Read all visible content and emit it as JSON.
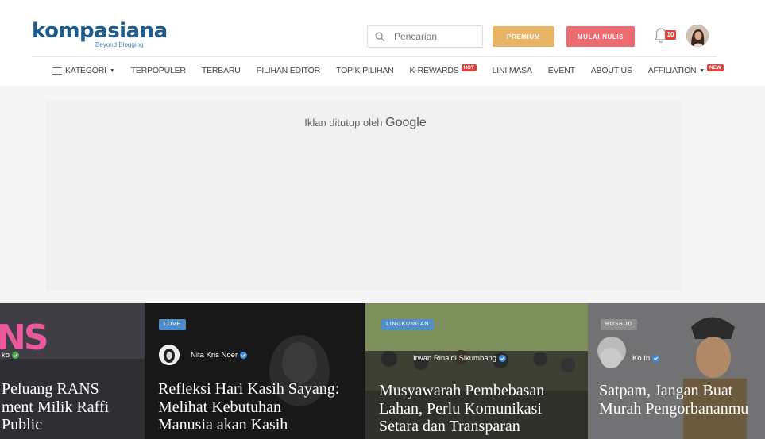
{
  "header": {
    "logo_text": "kompasiana",
    "logo_tagline": "Beyond Blogging",
    "search_placeholder": "Pencarian",
    "premium_label": "PREMIUM",
    "write_label": "MULAI NULIS",
    "notification_count": "10",
    "brand_color": "#1d5c8c",
    "premium_color": "#e7b466",
    "write_color": "#ec6a70"
  },
  "nav": {
    "items": [
      {
        "label": "KATEGORI",
        "icon": "hamburger-icon",
        "caret": true
      },
      {
        "label": "TERPOPULER"
      },
      {
        "label": "TERBARU"
      },
      {
        "label": "PILIHAN EDITOR"
      },
      {
        "label": "TOPIK PILIHAN"
      },
      {
        "label": "K-REWARDS",
        "badge": "HOT"
      },
      {
        "label": "LINI MASA"
      },
      {
        "label": "EVENT"
      },
      {
        "label": "ABOUT US"
      },
      {
        "label": "AFFILIATION",
        "caret": true,
        "badge": "NEW"
      }
    ]
  },
  "ad": {
    "text": "Iklan ditutup oleh",
    "brand": "Google"
  },
  "hero": {
    "cards": [
      {
        "tag": "",
        "author": "ko",
        "title_lines": [
          "Peluang RANS",
          "ment Milik Raffi",
          "Public"
        ],
        "logo_text": "NS"
      },
      {
        "tag": "LOVE",
        "author": "Nita Kris Noer",
        "title_lines": [
          "Refleksi Hari Kasih Sayang:",
          "Melihat Kebutuhan",
          "Manusia akan Kasih"
        ]
      },
      {
        "tag": "LINGKUNGAN",
        "author": "Irwan Rinaldi Sikumbang",
        "title_lines": [
          "Musyawarah Pembebasan",
          "Lahan, Perlu Komunikasi",
          "Setara dan Transparan"
        ]
      },
      {
        "tag": "BOSBUD",
        "author": "Ko In",
        "title_lines": [
          "Satpam, Jangan Buat",
          "Murah Pengorbananmu"
        ]
      }
    ]
  }
}
